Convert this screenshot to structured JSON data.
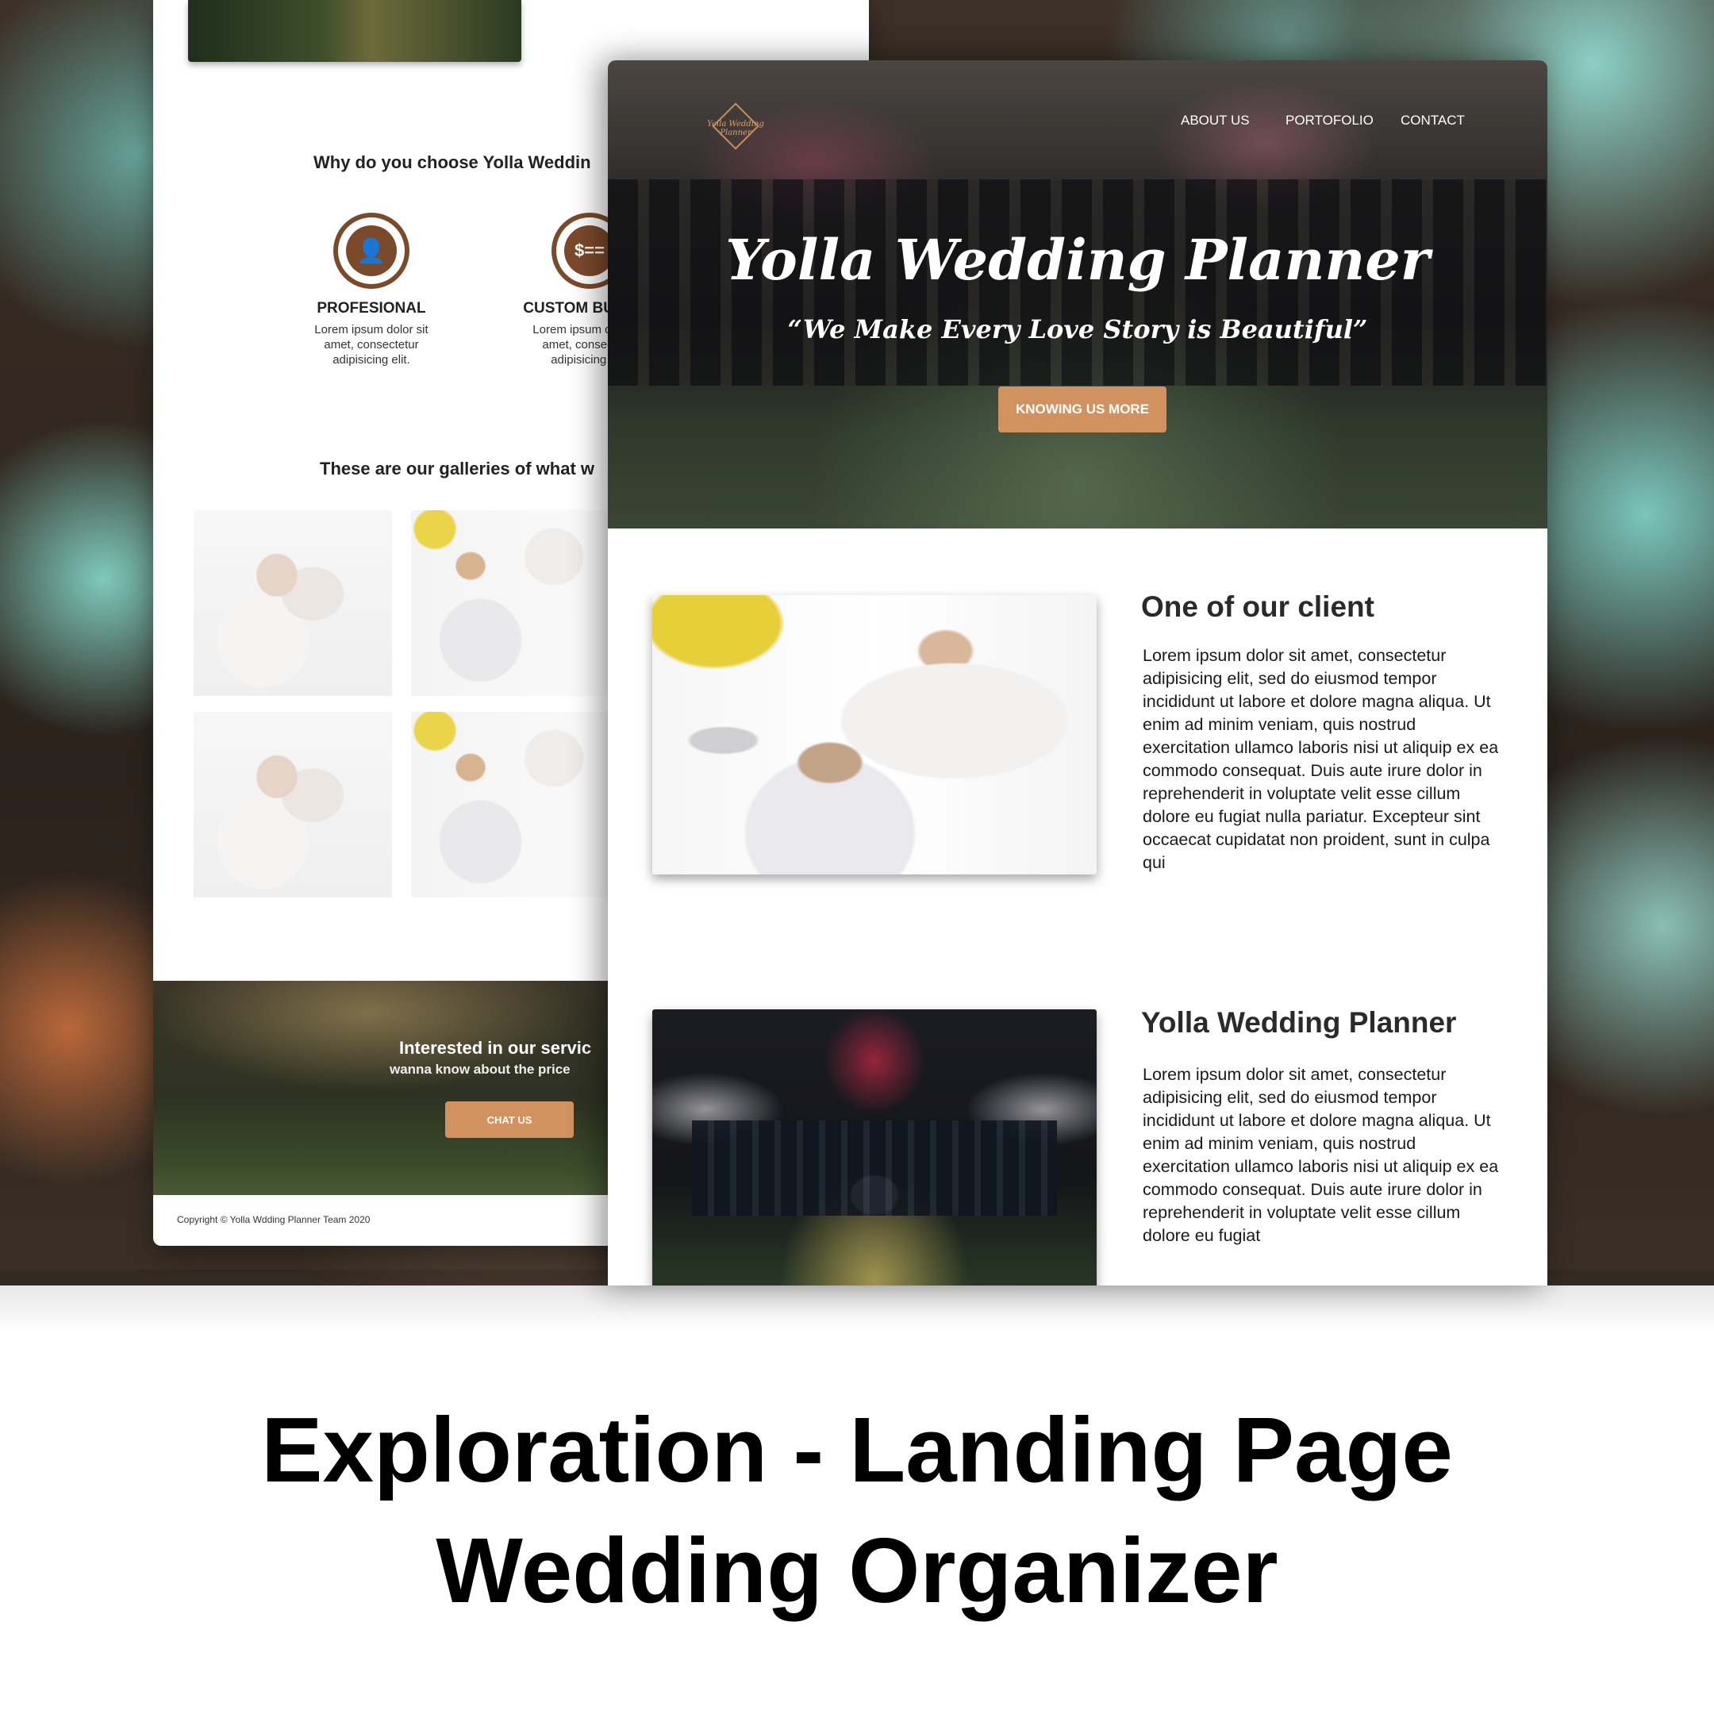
{
  "back_page": {
    "why_title": "Why do you choose Yolla Weddin",
    "features": [
      {
        "icon": "user-icon",
        "glyph": "👤",
        "title": "PROFESIONAL",
        "desc": "Lorem ipsum dolor sit amet, consectetur adipisicing elit."
      },
      {
        "icon": "dollar-card-icon",
        "glyph": "$==",
        "title": "CUSTOM BUDGET",
        "desc": "Lorem ipsum dolor sit amet, consectetur adipisicing elit."
      }
    ],
    "gallery_title": "These are our galleries of what w",
    "cta_line1": "Interested in our servic",
    "cta_line2": "wanna know about the price",
    "cta_button": "CHAT US",
    "copyright": "Copyright © Yolla Wdding Planner Team 2020"
  },
  "front_page": {
    "logo_text": "Yolla Wedding Planner",
    "nav": [
      "ABOUT US",
      "PORTOFOLIO",
      "CONTACT"
    ],
    "hero_title": "Yolla Wedding Planner",
    "hero_tagline": "“We Make Every Love Story is Beautiful”",
    "hero_button": "KNOWING US MORE",
    "section1": {
      "title": "One of our client",
      "body": "Lorem ipsum dolor sit amet, consectetur adipisicing elit, sed do eiusmod tempor incididunt ut labore et dolore magna aliqua. Ut enim ad minim veniam, quis nostrud exercitation ullamco laboris nisi ut aliquip ex ea commodo consequat. Duis aute irure dolor in reprehenderit in voluptate velit esse cillum dolore eu fugiat nulla pariatur. Excepteur sint occaecat cupidatat non proident, sunt in culpa qui"
    },
    "section2": {
      "title": "Yolla Wedding Planner",
      "body": "Lorem ipsum dolor sit amet, consectetur adipisicing elit, sed do eiusmod tempor incididunt ut labore et dolore magna aliqua. Ut enim ad minim veniam, quis nostrud exercitation ullamco laboris nisi ut aliquip ex ea commodo consequat. Duis aute irure dolor in reprehenderit in voluptate velit esse cillum dolore eu fugiat"
    }
  },
  "caption": {
    "line1": "Exploration - Landing Page",
    "line2": "Wedding Organizer"
  },
  "colors": {
    "accent": "#d2925f",
    "brown": "#7b4a2a"
  }
}
